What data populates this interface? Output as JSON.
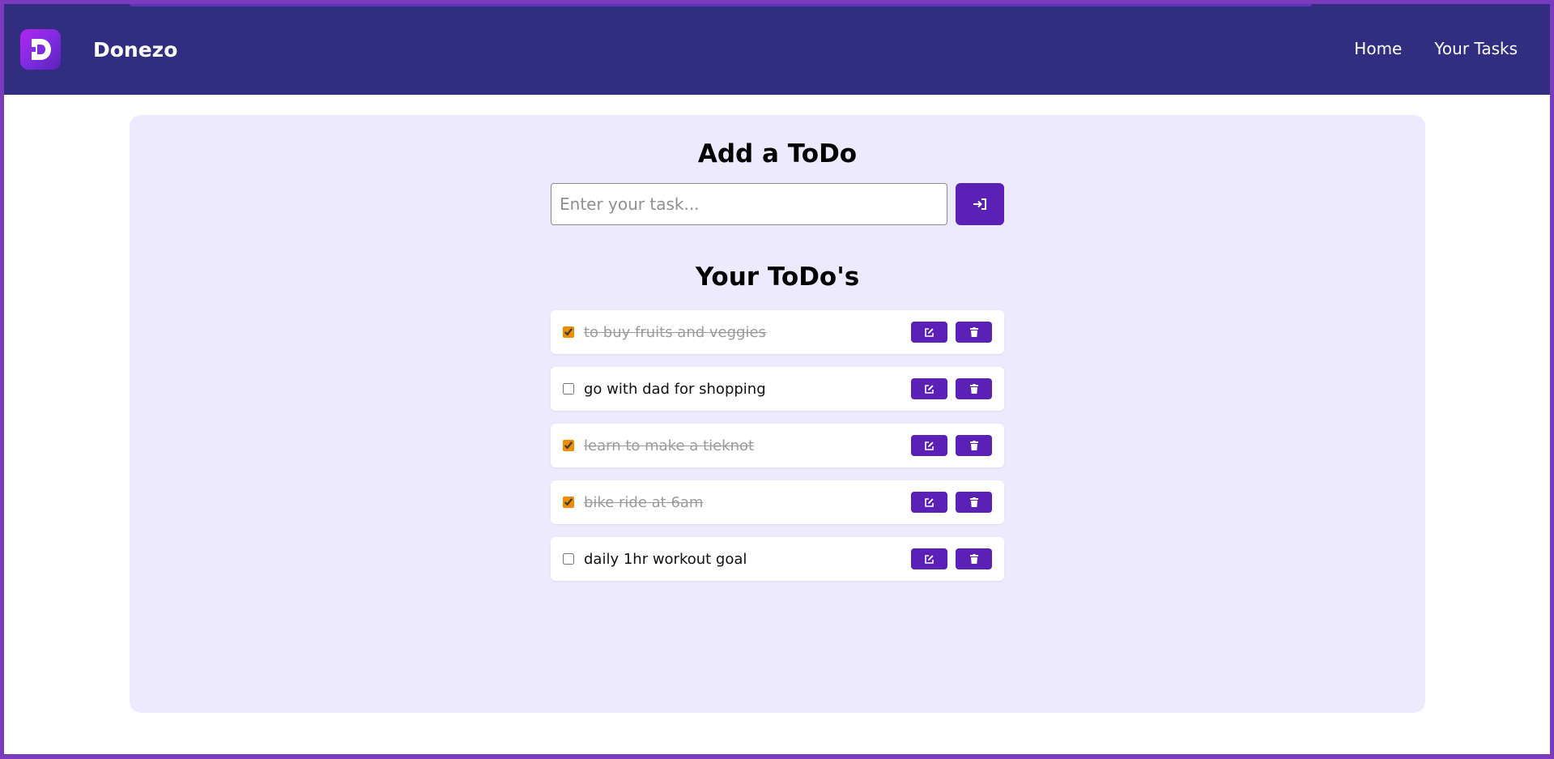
{
  "navbar": {
    "logo_letter": "D",
    "brand": "Donezo",
    "links": [
      {
        "label": "Home"
      },
      {
        "label": "Your Tasks"
      }
    ]
  },
  "add_section": {
    "title": "Add a ToDo",
    "input_placeholder": "Enter your task...",
    "input_value": "",
    "submit_icon": "sign-in-arrow-icon"
  },
  "list_section": {
    "title": "Your ToDo's",
    "items": [
      {
        "text": "to buy fruits and veggies",
        "done": true
      },
      {
        "text": "go with dad for shopping",
        "done": false
      },
      {
        "text": "learn to make a tieknot",
        "done": true
      },
      {
        "text": "bike ride at 6am",
        "done": true
      },
      {
        "text": "daily 1hr workout goal",
        "done": false
      }
    ],
    "edit_icon": "edit-icon",
    "delete_icon": "trash-icon"
  },
  "colors": {
    "navbar_bg": "#312e81",
    "accent": "#5b21b6",
    "panel_bg": "#ede9fe",
    "checkbox": "#f08c00"
  }
}
